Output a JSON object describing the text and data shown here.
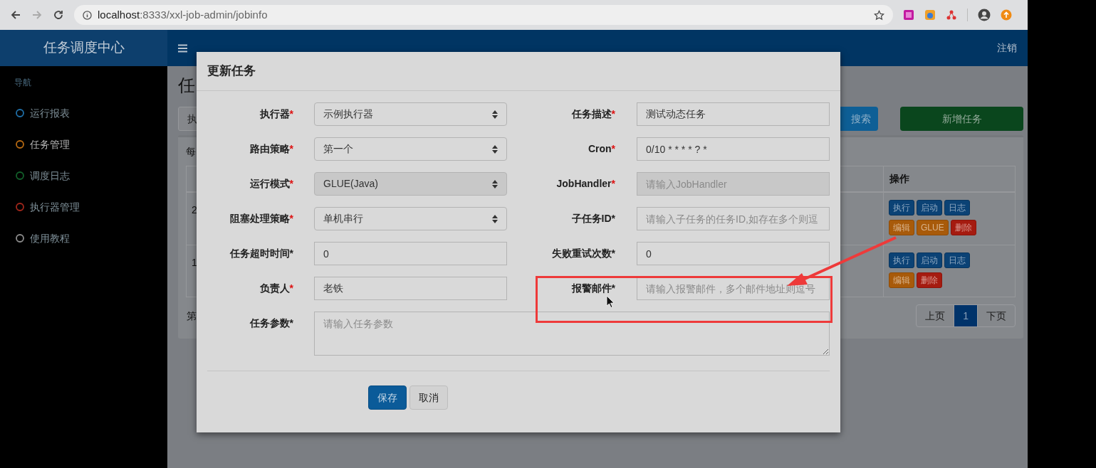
{
  "browser": {
    "url_host": "localhost",
    "url_path": ":8333/xxl-job-admin/jobinfo"
  },
  "header": {
    "logo": "任务调度中心",
    "logout": "注销"
  },
  "sidebar": {
    "heading": "导航",
    "items": [
      {
        "label": "运行报表",
        "color": "#1f6fa8",
        "selected": false
      },
      {
        "label": "任务管理",
        "color": "#b86a12",
        "selected": true
      },
      {
        "label": "调度日志",
        "color": "#12602a",
        "selected": false
      },
      {
        "label": "执行器管理",
        "color": "#a3271b",
        "selected": false
      },
      {
        "label": "使用教程",
        "color": "#8c8c8c",
        "selected": false
      }
    ]
  },
  "page": {
    "title": "任",
    "filter_button": "执",
    "search_button": "搜索",
    "add_button": "新增任务",
    "length_text": "每",
    "table": {
      "columns": [
        "操作"
      ],
      "rows": [
        {
          "cells": [
            "2"
          ],
          "actions": [
            {
              "label": "执行",
              "kind": "primary"
            },
            {
              "label": "启动",
              "kind": "primary"
            },
            {
              "label": "日志",
              "kind": "primary"
            },
            {
              "label": "编辑",
              "kind": "warning"
            },
            {
              "label": "GLUE",
              "kind": "warning"
            },
            {
              "label": "删除",
              "kind": "danger"
            }
          ]
        },
        {
          "cells": [
            "1"
          ],
          "actions": [
            {
              "label": "执行",
              "kind": "primary"
            },
            {
              "label": "启动",
              "kind": "primary"
            },
            {
              "label": "日志",
              "kind": "primary"
            },
            {
              "label": "编辑",
              "kind": "warning"
            },
            {
              "label": "删除",
              "kind": "danger"
            }
          ]
        }
      ]
    },
    "info_text": "第",
    "pagination": [
      {
        "label": "上页",
        "selected": false
      },
      {
        "label": "1",
        "selected": true
      },
      {
        "label": "下页",
        "selected": false
      }
    ]
  },
  "dialog": {
    "title": "更新任务",
    "rows": [
      [
        {
          "label": "执行器",
          "marker": "*",
          "required": true,
          "kind": "select",
          "value": "示例执行器",
          "disabled": false
        },
        {
          "label": "任务描述",
          "marker": "*",
          "required": true,
          "kind": "input",
          "value": "测试动态任务",
          "disabled": false
        }
      ],
      [
        {
          "label": "路由策略",
          "marker": "*",
          "required": true,
          "kind": "select",
          "value": "第一个",
          "disabled": false
        },
        {
          "label": "Cron",
          "marker": "*",
          "required": true,
          "kind": "input",
          "value": "0/10 * * * * ? *",
          "disabled": false
        }
      ],
      [
        {
          "label": "运行模式",
          "marker": "*",
          "required": true,
          "kind": "select",
          "value": "GLUE(Java)",
          "disabled": true
        },
        {
          "label": "JobHandler",
          "marker": "*",
          "required": true,
          "kind": "input",
          "placeholder": "请输入JobHandler",
          "disabled": true
        }
      ],
      [
        {
          "label": "阻塞处理策略",
          "marker": "*",
          "required": true,
          "kind": "select",
          "value": "单机串行",
          "disabled": false
        },
        {
          "label": "子任务ID",
          "marker": "*",
          "required": false,
          "kind": "input",
          "placeholder": "请输入子任务的任务ID,如存在多个则逗",
          "disabled": false
        }
      ],
      [
        {
          "label": "任务超时时间",
          "marker": "*",
          "required": false,
          "kind": "input",
          "value": "0",
          "disabled": false
        },
        {
          "label": "失败重试次数",
          "marker": "*",
          "required": false,
          "kind": "input",
          "value": "0",
          "disabled": false
        }
      ],
      [
        {
          "label": "负责人",
          "marker": "*",
          "required": true,
          "kind": "input",
          "value": "老铁",
          "disabled": false
        },
        {
          "label": "报警邮件",
          "marker": "*",
          "required": false,
          "kind": "input",
          "placeholder": "请输入报警邮件，多个邮件地址则逗号",
          "disabled": false
        }
      ]
    ],
    "params": {
      "label": "任务参数",
      "marker": "*",
      "required": false,
      "placeholder": "请输入任务参数"
    },
    "buttons": [
      {
        "label": "保存",
        "kind": "primary"
      },
      {
        "label": "取消",
        "kind": "default"
      }
    ]
  }
}
